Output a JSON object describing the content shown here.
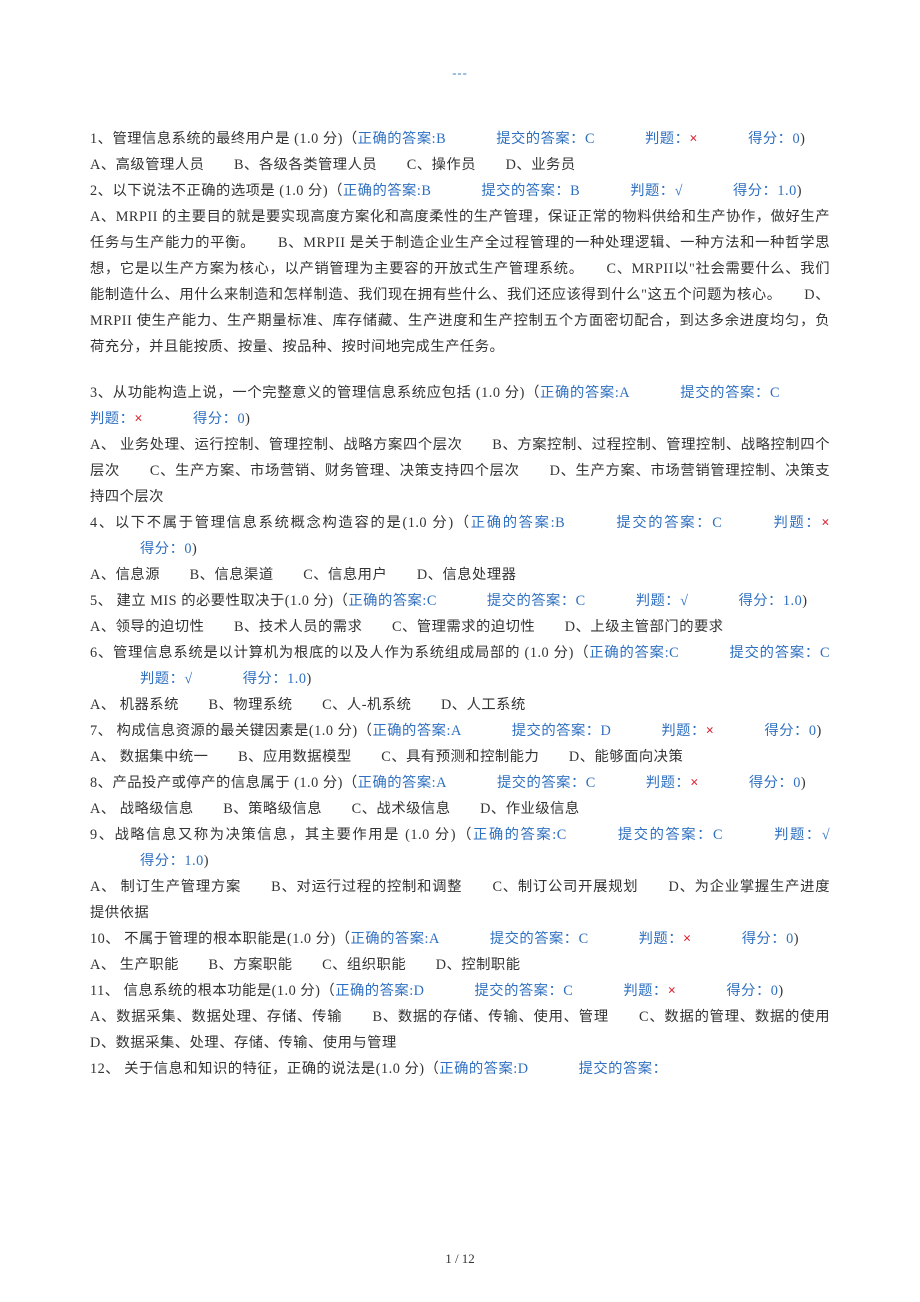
{
  "header": "---",
  "footer": "1 / 12",
  "labels": {
    "correct": "正确的答案",
    "submitted": "提交的答案：",
    "verdict": "判题：",
    "score": "得分：",
    "points_suffix": "分"
  },
  "questions": [
    {
      "num": "1",
      "text": "管理信息系统的最终用户是",
      "points": "1.0",
      "correct": "B",
      "submitted": "C",
      "pass": false,
      "score": "0",
      "options": "A、高级管理人员　　B、各级各类管理人员　　C、操作员　　D、业务员"
    },
    {
      "num": "2",
      "text": "以下说法不正确的选项是",
      "points": "1.0",
      "correct": "B",
      "submitted": "B",
      "pass": true,
      "score": "1.0",
      "options": "A、MRPII 的主要目的就是要实现高度方案化和高度柔性的生产管理，保证正常的物料供给和生产协作，做好生产任务与生产能力的平衡。　　B、MRPII 是关于制造企业生产全过程管理的一种处理逻辑、一种方法和一种哲学思想，它是以生产方案为核心，以产销管理为主要容的开放式生产管理系统。　　C、MRPII以\"社会需要什么、我们能制造什么、用什么来制造和怎样制造、我们现在拥有些什么、我们还应该得到什么\"这五个问题为核心。　　D、MRPII 使生产能力、生产期量标准、库存储藏、生产进度和生产控制五个方面密切配合，到达多余进度均匀，负荷充分，并且能按质、按量、按品种、按时间地完成生产任务。"
    },
    {
      "num": "3",
      "text": "从功能构造上说，一个完整意义的管理信息系统应包括",
      "points": "1.0",
      "correct": "A",
      "submitted": "C",
      "pass": false,
      "score": "0",
      "options": "A、 业务处理、运行控制、管理控制、战略方案四个层次　　B、方案控制、过程控制、管理控制、战略控制四个层次　　C、生产方案、市场营销、财务管理、决策支持四个层次　　D、生产方案、市场营销管理控制、决策支持四个层次"
    },
    {
      "num": "4",
      "text": "以下不属于管理信息系统概念构造容的是",
      "points": "1.0",
      "correct": "B",
      "submitted": "C",
      "pass": false,
      "score": "0",
      "options": "A、信息源　　B、信息渠道　　C、信息用户　　D、信息处理器"
    },
    {
      "num": "5",
      "text": " 建立 MIS 的必要性取决于",
      "points": "1.0",
      "correct": "C",
      "submitted": "C",
      "pass": true,
      "score": "1.0",
      "options": "A、领导的迫切性　　B、技术人员的需求　　C、管理需求的迫切性　　D、上级主管部门的要求"
    },
    {
      "num": "6",
      "text": "管理信息系统是以计算机为根底的以及人作为系统组成局部的",
      "points": "1.0",
      "correct": "C",
      "submitted": "C",
      "pass": true,
      "score": "1.0",
      "options": "A、 机器系统　　B、物理系统　　C、人-机系统　　D、人工系统"
    },
    {
      "num": "7",
      "text": " 构成信息资源的最关键因素是",
      "points": "1.0",
      "correct": "A",
      "submitted": "D",
      "pass": false,
      "score": "0",
      "options": "A、 数据集中统一　　B、应用数据模型　　C、具有预测和控制能力　　D、能够面向决策"
    },
    {
      "num": "8",
      "text": "产品投产或停产的信息属于",
      "points": "1.0",
      "correct": "A",
      "submitted": "C",
      "pass": false,
      "score": "0",
      "options": "A、 战略级信息　　B、策略级信息　　C、战术级信息　　D、作业级信息"
    },
    {
      "num": "9",
      "text": "战略信息又称为决策信息，其主要作用是",
      "points": "1.0",
      "correct": "C",
      "submitted": "C",
      "pass": true,
      "score": "1.0",
      "options": "A、 制订生产管理方案　　B、对运行过程的控制和调整　　C、制订公司开展规划　　D、为企业掌握生产进度提供依据"
    },
    {
      "num": "10",
      "text": " 不属于管理的根本职能是",
      "points": "1.0",
      "correct": "A",
      "submitted": "C",
      "pass": false,
      "score": "0",
      "options": "A、 生产职能　　B、方案职能　　C、组织职能　　D、控制职能"
    },
    {
      "num": "11",
      "text": " 信息系统的根本功能是",
      "points": "1.0",
      "correct": "D",
      "submitted": "C",
      "pass": false,
      "score": "0",
      "options": "A、数据采集、数据处理、存储、传输　　B、数据的存储、传输、使用、管理　　C、数据的管理、数据的使用　　D、数据采集、处理、存储、传输、使用与管理"
    },
    {
      "num": "12",
      "text": " 关于信息和知识的特征，正确的说法是",
      "points": "1.0",
      "correct": "D",
      "submitted": "",
      "pass": null,
      "score": null,
      "options": ""
    }
  ]
}
